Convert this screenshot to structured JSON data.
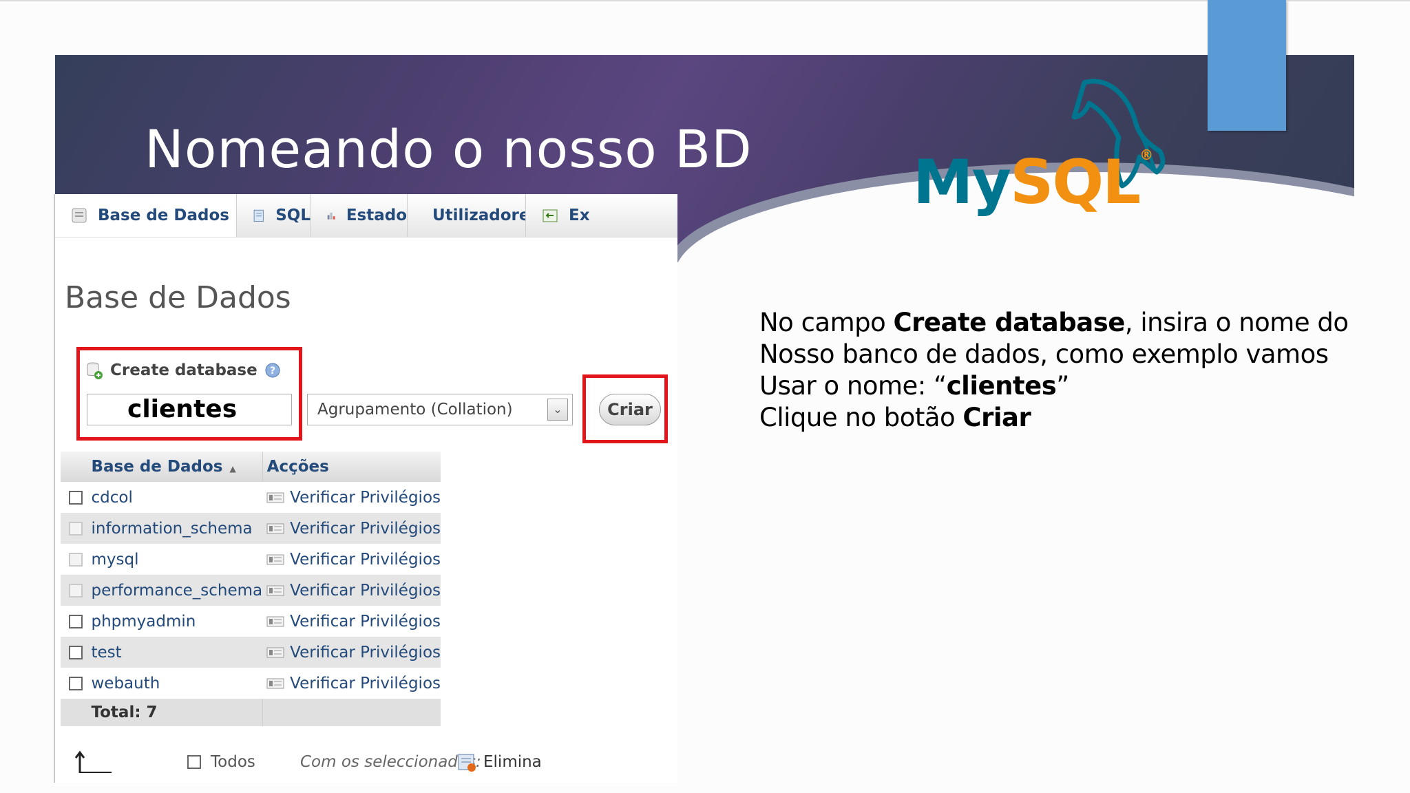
{
  "slide": {
    "title": "Nomeando o nosso BD"
  },
  "logo": {
    "my": "My",
    "sql": "SQL",
    "reg": "®"
  },
  "colors": {
    "banner": "#4d3f70",
    "accent_tab": "#5b9bd5",
    "highlight": "#e2151b",
    "mysql_blue": "#00758f",
    "mysql_orange": "#f29111"
  },
  "pma": {
    "tabs": [
      {
        "label": "Base de Dados",
        "icon": "database-icon"
      },
      {
        "label": "SQL",
        "icon": "sql-icon"
      },
      {
        "label": "Estado",
        "icon": "status-icon"
      },
      {
        "label": "Utilizadores",
        "icon": "users-icon"
      },
      {
        "label": "Ex",
        "icon": "export-icon"
      }
    ],
    "heading": "Base de Dados",
    "create_label": "Create database",
    "db_name_value": "clientes",
    "collation_placeholder": "Agrupamento (Collation)",
    "create_button": "Criar",
    "table": {
      "col_db": "Base de Dados",
      "col_actions": "Acções",
      "rows": [
        {
          "name": "cdcol",
          "action": "Verificar Privilégios"
        },
        {
          "name": "information_schema",
          "action": "Verificar Privilégios"
        },
        {
          "name": "mysql",
          "action": "Verificar Privilégios"
        },
        {
          "name": "performance_schema",
          "action": "Verificar Privilégios"
        },
        {
          "name": "phpmyadmin",
          "action": "Verificar Privilégios"
        },
        {
          "name": "test",
          "action": "Verificar Privilégios"
        },
        {
          "name": "webauth",
          "action": "Verificar Privilégios"
        }
      ],
      "total": "Total: 7"
    },
    "footer": {
      "todos": "Todos",
      "com_selecionados": "Com os seleccionados:",
      "elimina": "Elimina"
    }
  },
  "instructions": {
    "l1_pre": "No campo ",
    "l1_bold": "Create database",
    "l1_post": ", insira o nome do",
    "l2": "Nosso banco de dados, como exemplo vamos",
    "l3_pre": "Usar o nome: “",
    "l3_bold": "clientes",
    "l3_post": "”",
    "l4_pre": "Clique no botão ",
    "l4_bold": "Criar"
  }
}
